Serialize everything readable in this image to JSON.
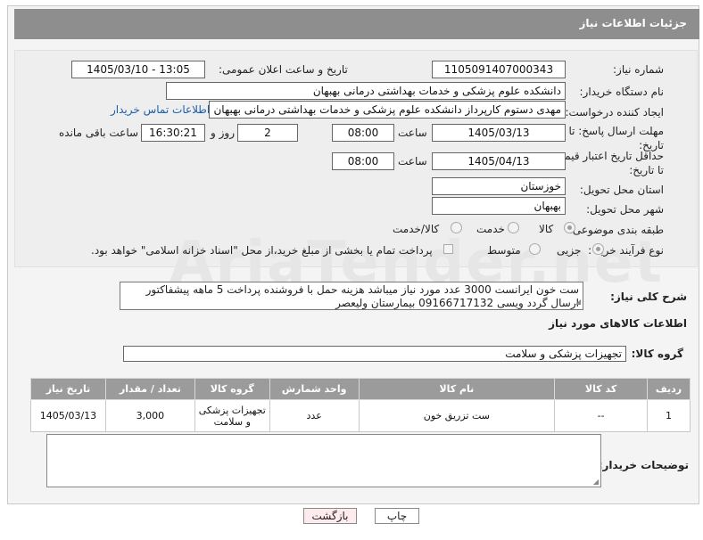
{
  "header": {
    "title": "جزئیات اطلاعات نیاز"
  },
  "form": {
    "need_number_label": "شماره نیاز:",
    "need_number": "1105091407000343",
    "announce_label": "تاریخ و ساعت اعلان عمومی:",
    "announce_value": "1405/03/10 - 13:05",
    "buyer_org_label": "نام دستگاه خریدار:",
    "buyer_org": "دانشکده علوم پزشکی و خدمات بهداشتی  درمانی بهبهان",
    "requester_label": "ایجاد کننده درخواست:",
    "requester": "مهدی دستوم کارپرداز دانشکده علوم پزشکی و خدمات بهداشتی  درمانی بهبهان",
    "contact_link": "اطلاعات تماس خریدار",
    "reply_deadline_label": "مهلت ارسال پاسخ: تا تاریخ:",
    "reply_date": "1405/03/13",
    "time_label": "ساعت",
    "reply_time": "08:00",
    "days_value": "2",
    "days_label": "روز و",
    "remaining_time": "16:30:21",
    "remaining_label": "ساعت باقی مانده",
    "price_validity_label": "حداقل تاریخ اعتبار قیمت: تا تاریخ:",
    "validity_date": "1405/04/13",
    "validity_time": "08:00",
    "province_label": "استان محل تحویل:",
    "province": "خوزستان",
    "city_label": "شهر محل تحویل:",
    "city": "بهبهان",
    "category_label": "طبقه بندی موضوعی:",
    "category_options": {
      "goods": "کالا",
      "service": "خدمت",
      "both": "کالا/خدمت"
    },
    "category_selected": "کالا",
    "process_label": "نوع فرآیند خرید :",
    "process_options": {
      "small": "جزیی",
      "medium": "متوسط"
    },
    "process_selected": "جزیی",
    "payment_note": "پرداخت تمام یا بخشی از مبلغ خرید،از محل \"اسناد خزانه اسلامی\" خواهد بود."
  },
  "description": {
    "label": "شرح کلی نیاز:",
    "text": "ست خون ایرانست 3000 عدد مورد نیاز میباشد هزینه حمل با فروشنده پرداخت 5 ماهه پیشفاکتور ارسال گردد ویسی 09166717132 بیمارستان ولیعصر"
  },
  "goods_info": {
    "title": "اطلاعات کالاهای مورد نیاز",
    "group_label": "گروه کالا:",
    "group_value": "تجهیزات پزشکی و سلامت"
  },
  "table": {
    "headers": [
      "ردیف",
      "کد کالا",
      "نام کالا",
      "واحد شمارش",
      "گروه کالا",
      "تعداد / مقدار",
      "تاریخ نیاز"
    ],
    "rows": [
      {
        "row": "1",
        "code": "--",
        "name": "ست تزریق خون",
        "unit": "عدد",
        "group": "تجهیزات پزشکی و سلامت",
        "qty": "3,000",
        "date": "1405/03/13"
      }
    ]
  },
  "notes": {
    "label": "توضیحات خریدار:"
  },
  "buttons": {
    "print": "چاپ",
    "back": "بازگشت"
  },
  "watermark": "AriaTender.net"
}
